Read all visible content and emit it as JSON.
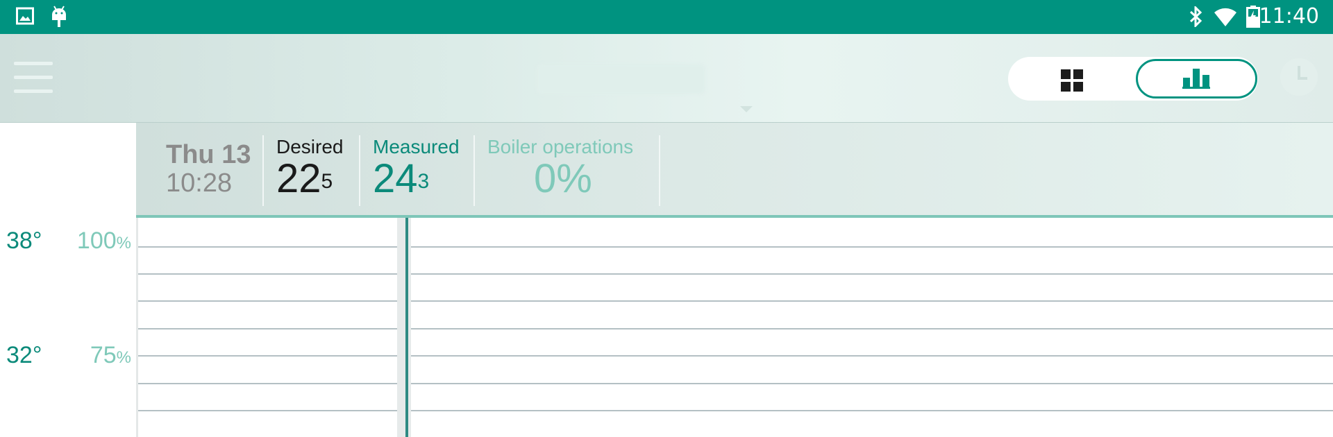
{
  "status_bar": {
    "time": "11:40",
    "left_icons": [
      "gallery-icon",
      "android-icon"
    ],
    "right_icons": [
      "bluetooth-icon",
      "wifi-icon",
      "battery-charging-icon"
    ],
    "color": "#009380"
  },
  "app_bar": {
    "menu_icon": "hamburger-menu-icon",
    "views": [
      "grid-view",
      "chart-view"
    ],
    "selected_view": "chart-view",
    "clock_icon": "clock-icon"
  },
  "info": {
    "day": "Thu 13",
    "time": "10:28",
    "desired_label": "Desired",
    "desired_int": "22",
    "desired_dec": "5",
    "measured_label": "Measured",
    "measured_int": "24",
    "measured_dec": "3",
    "boiler_label": "Boiler operations",
    "boiler_value": "0%"
  },
  "scale": [
    {
      "temp": "38°",
      "pct": "100",
      "pct_unit": "%"
    },
    {
      "temp": "32°",
      "pct": "75",
      "pct_unit": "%"
    }
  ],
  "colors": {
    "accent": "#009380",
    "measured": "#0b8a7a",
    "boiler": "#7fc9b9",
    "desired": "#1a1a1a"
  }
}
